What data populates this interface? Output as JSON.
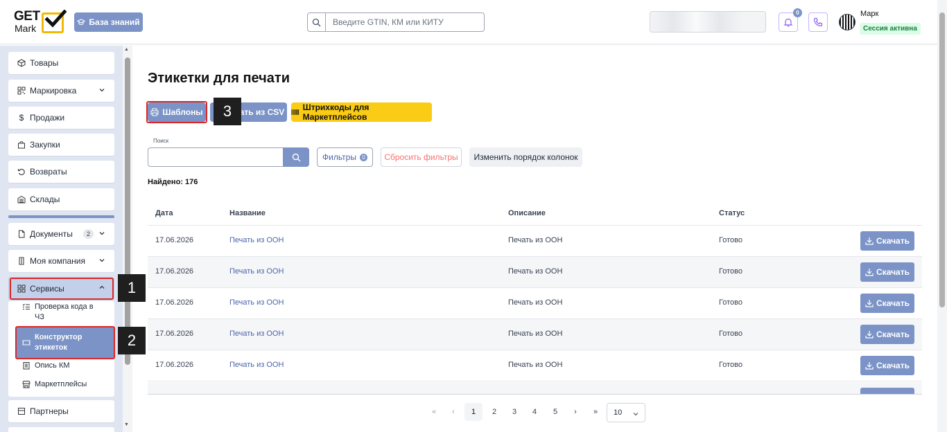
{
  "header": {
    "logo_top": "GET",
    "logo_bottom": "Mark",
    "kb_button": "База знаний",
    "search_placeholder": "Введите GTIN, КМ или КИТУ",
    "notifications_count": "0",
    "user_name": "Марк",
    "session_status": "Сессия активна"
  },
  "sidebar": {
    "items": [
      {
        "label": "Товары",
        "icon": "box-icon"
      },
      {
        "label": "Маркировка",
        "icon": "qr-icon"
      },
      {
        "label": "Продажи",
        "icon": "dollar-icon"
      },
      {
        "label": "Закупки",
        "icon": "bag-icon"
      },
      {
        "label": "Возвраты",
        "icon": "return-icon"
      },
      {
        "label": "Склады",
        "icon": "warehouse-icon"
      }
    ],
    "documents": {
      "label": "Документы",
      "count": "2"
    },
    "company": {
      "label": "Моя компания"
    },
    "services": {
      "label": "Сервисы",
      "children": [
        {
          "label": "Проверка кода в ЧЗ"
        },
        {
          "label": "Конструктор этикеток"
        },
        {
          "label": "Опись КМ"
        },
        {
          "label": "Маркетплейсы"
        }
      ]
    },
    "partners": {
      "label": "Партнеры"
    }
  },
  "steps": [
    "1",
    "2",
    "3"
  ],
  "main": {
    "title": "Этикетки для печати",
    "btn_templates": "Шаблоны",
    "btn_csv": "Печать из CSV",
    "btn_barcodes": "Штрихкоды для Маркетплейсов",
    "search_label": "Поиск",
    "search_value": "",
    "btn_filters": "Фильтры",
    "filters_count": "0",
    "btn_reset": "Сбросить фильтры",
    "btn_columns": "Изменить порядок колонок",
    "found": "Найдено: 176"
  },
  "table": {
    "columns": [
      "Дата",
      "Название",
      "Описание",
      "Статус"
    ],
    "download_label": "Скачать",
    "rows": [
      {
        "date": "17.06.2026",
        "name": "Печать из ООН",
        "description": "Печать из ООН",
        "status": "Готово"
      },
      {
        "date": "17.06.2026",
        "name": "Печать из ООН",
        "description": "Печать из ООН",
        "status": "Готово"
      },
      {
        "date": "17.06.2026",
        "name": "Печать из ООН",
        "description": "Печать из ООН",
        "status": "Готово"
      },
      {
        "date": "17.06.2026",
        "name": "Печать из ООН",
        "description": "Печать из ООН",
        "status": "Готово"
      },
      {
        "date": "17.06.2026",
        "name": "Печать из ООН",
        "description": "Печать из ООН",
        "status": "Готово"
      }
    ]
  },
  "pagination": {
    "first": "«",
    "prev": "‹",
    "pages": [
      "1",
      "2",
      "3",
      "4",
      "5"
    ],
    "current": "1",
    "next": "›",
    "last": "»",
    "per_page": "10"
  },
  "colors": {
    "accent": "#7b93c7",
    "yellow": "#facc15",
    "highlight": "#dc2626",
    "sidebar_bg": "#dfe5f1",
    "success_bg": "#dcfce7",
    "success_text": "#15803d"
  }
}
